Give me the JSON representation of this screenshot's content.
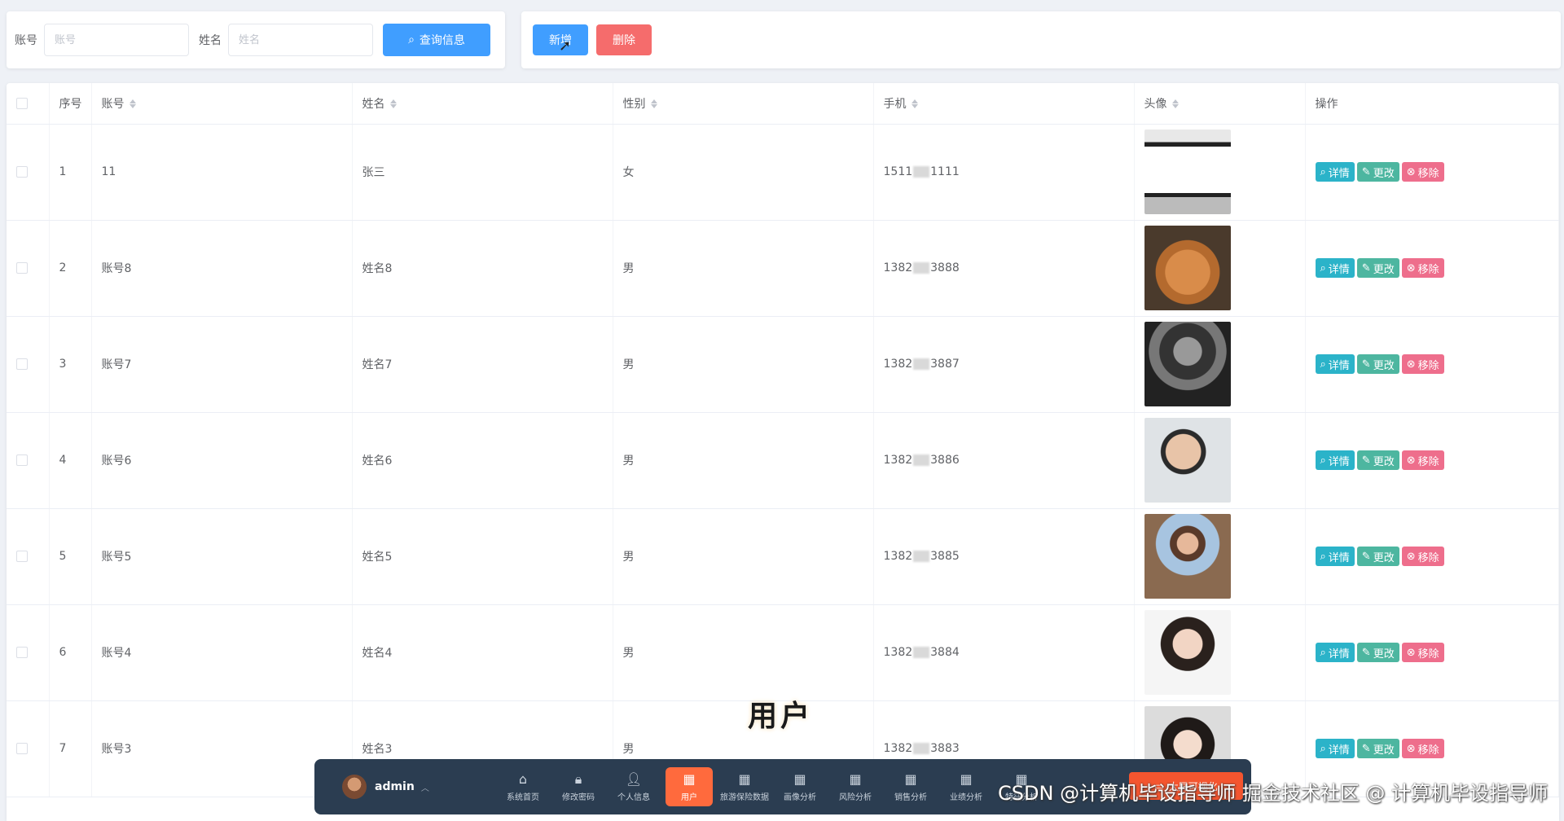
{
  "search": {
    "account_label": "账号",
    "account_placeholder": "账号",
    "name_label": "姓名",
    "name_placeholder": "姓名",
    "query_button": "查询信息"
  },
  "actions": {
    "add_button": "新增",
    "delete_button": "删除"
  },
  "table": {
    "headers": {
      "index": "序号",
      "account": "账号",
      "name": "姓名",
      "gender": "性别",
      "phone": "手机",
      "avatar": "头像",
      "ops": "操作"
    },
    "rows": [
      {
        "index": "1",
        "account": "11",
        "name": "张三",
        "gender": "女",
        "phone_a": "1511",
        "phone_b": "1111",
        "avatar": "study-poster-image"
      },
      {
        "index": "2",
        "account": "账号8",
        "name": "姓名8",
        "gender": "男",
        "phone_a": "1382",
        "phone_b": "3888",
        "avatar": "cat-photo"
      },
      {
        "index": "3",
        "account": "账号7",
        "name": "姓名7",
        "gender": "男",
        "phone_a": "1382",
        "phone_b": "3887",
        "avatar": "man-portrait-bw"
      },
      {
        "index": "4",
        "account": "账号6",
        "name": "姓名6",
        "gender": "男",
        "phone_a": "1382",
        "phone_b": "3886",
        "avatar": "man-portrait"
      },
      {
        "index": "5",
        "account": "账号5",
        "name": "姓名5",
        "gender": "男",
        "phone_a": "1382",
        "phone_b": "3885",
        "avatar": "woman-street-photo"
      },
      {
        "index": "6",
        "account": "账号4",
        "name": "姓名4",
        "gender": "男",
        "phone_a": "1382",
        "phone_b": "3884",
        "avatar": "woman-portrait"
      },
      {
        "index": "7",
        "account": "账号3",
        "name": "姓名3",
        "gender": "男",
        "phone_a": "1382",
        "phone_b": "3883",
        "avatar": "girl-portrait"
      }
    ],
    "ops": {
      "detail": "详情",
      "edit": "更改",
      "remove": "移除"
    }
  },
  "dock": {
    "username": "admin",
    "items": [
      {
        "label": "系统首页",
        "icon": "home-icon",
        "glyph": "⌂"
      },
      {
        "label": "修改密码",
        "icon": "lock-icon",
        "glyph": "🔒︎"
      },
      {
        "label": "个人信息",
        "icon": "person-icon",
        "glyph": "👤︎"
      },
      {
        "label": "用户",
        "icon": "grid-icon",
        "glyph": "▦",
        "active": true
      },
      {
        "label": "旅游保险数据",
        "icon": "grid-icon",
        "glyph": "▦"
      },
      {
        "label": "画像分析",
        "icon": "grid-icon",
        "glyph": "▦"
      },
      {
        "label": "风险分析",
        "icon": "grid-icon",
        "glyph": "▦"
      },
      {
        "label": "销售分析",
        "icon": "grid-icon",
        "glyph": "▦"
      },
      {
        "label": "业绩分析",
        "icon": "grid-icon",
        "glyph": "▦"
      },
      {
        "label": "特征分析",
        "icon": "grid-icon",
        "glyph": "▦"
      }
    ],
    "big_screen_button": "大屏可视化"
  },
  "caption": "用户",
  "watermark": "CSDN @计算机毕设指导师  掘金技术社区 @ 计算机毕设指导师",
  "colors": {
    "primary": "#409eff",
    "danger": "#f56c6c",
    "dock_bg": "#2b3d51",
    "dock_active": "#ff6a3d"
  }
}
